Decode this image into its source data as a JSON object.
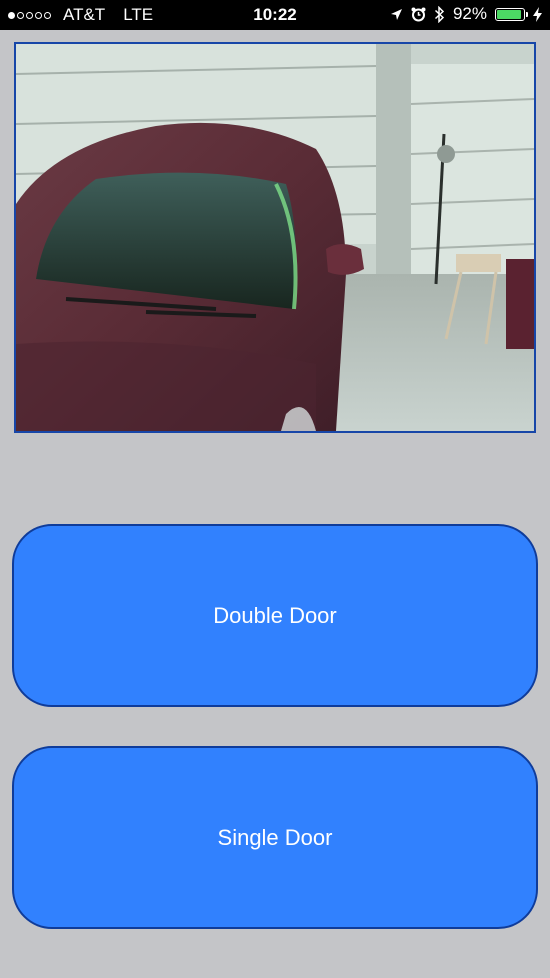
{
  "status_bar": {
    "signal_filled": 1,
    "signal_total": 5,
    "carrier": "AT&T",
    "network": "LTE",
    "time": "10:22",
    "battery_percent": "92%",
    "battery_level": 0.92,
    "icons": [
      "location-arrow-icon",
      "alarm-clock-icon",
      "bluetooth-icon",
      "battery-icon",
      "charging-bolt-icon"
    ]
  },
  "camera": {
    "icon": "garage-camera-feed"
  },
  "buttons": {
    "double_door": "Double Door",
    "single_door": "Single Door"
  },
  "colors": {
    "background": "#c4c5c8",
    "button_fill": "#3181fe",
    "button_border": "#0f3c9a",
    "camera_border": "#1746a8",
    "battery_green": "#4cd964"
  }
}
